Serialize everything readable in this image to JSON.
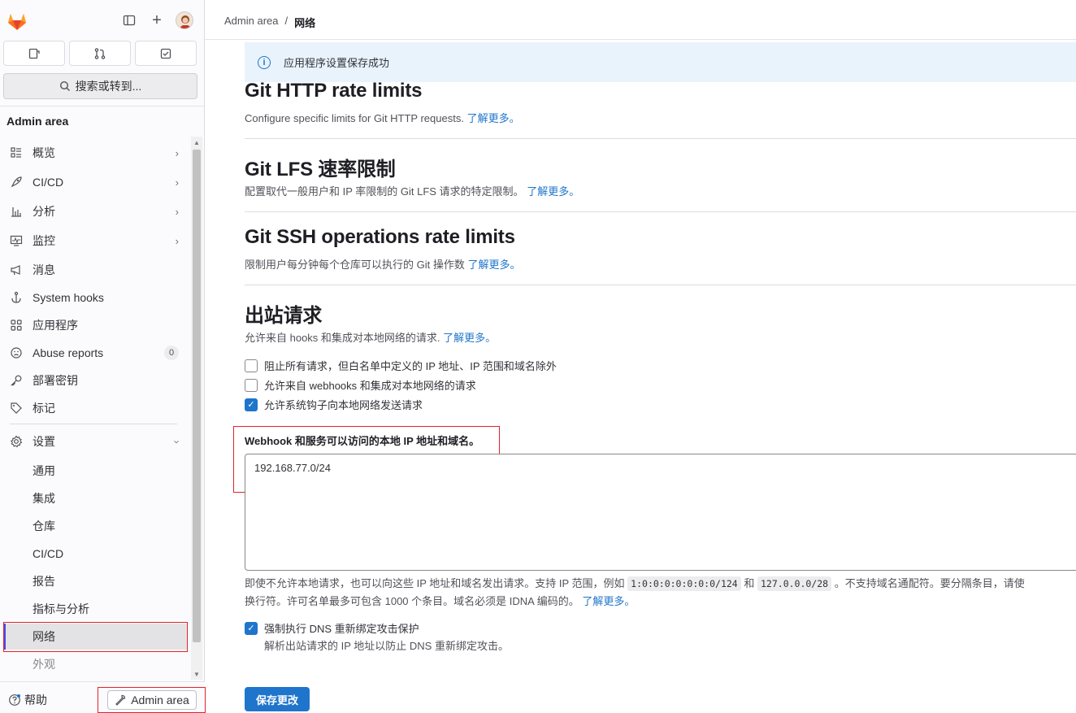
{
  "sidebar": {
    "search_label": "搜索或转到...",
    "section_title": "Admin area",
    "items": [
      {
        "label": "概览",
        "icon": "overview-icon"
      },
      {
        "label": "CI/CD",
        "icon": "rocket-icon"
      },
      {
        "label": "分析",
        "icon": "chart-icon"
      },
      {
        "label": "监控",
        "icon": "monitor-icon"
      },
      {
        "label": "消息",
        "icon": "bullhorn-icon"
      },
      {
        "label": "System hooks",
        "icon": "anchor-icon"
      },
      {
        "label": "应用程序",
        "icon": "apps-icon"
      },
      {
        "label": "Abuse reports",
        "icon": "face-icon",
        "badge": "0"
      },
      {
        "label": "部署密钥",
        "icon": "key-icon"
      },
      {
        "label": "标记",
        "icon": "label-icon"
      },
      {
        "label": "设置",
        "icon": "settings-icon"
      }
    ],
    "sub_items": [
      "通用",
      "集成",
      "仓库",
      "CI/CD",
      "报告",
      "指标与分析",
      "网络",
      "外观"
    ],
    "help_label": "帮助",
    "admin_button_label": "Admin area"
  },
  "breadcrumb": {
    "root": "Admin area",
    "sep": "/",
    "current": "网络"
  },
  "alert": {
    "text": "应用程序设置保存成功"
  },
  "sections": [
    {
      "title": "Git HTTP rate limits",
      "desc": "Configure specific limits for Git HTTP requests.",
      "link": "了解更多。"
    },
    {
      "title": "Git LFS 速率限制",
      "desc": "配置取代一般用户和 IP 率限制的 Git LFS 请求的特定限制。",
      "link": "了解更多。"
    },
    {
      "title": "Git SSH operations rate limits",
      "desc": "限制用户每分钟每个仓库可以执行的 Git 操作数",
      "link": "了解更多。"
    },
    {
      "title": "出站请求",
      "desc": "允许来自 hooks 和集成对本地网络的请求.",
      "link": "了解更多。"
    }
  ],
  "checkboxes": [
    {
      "label": "阻止所有请求，但白名单中定义的 IP 地址、IP 范围和域名除外",
      "checked": false
    },
    {
      "label": "允许来自 webhooks 和集成对本地网络的请求",
      "checked": false
    },
    {
      "label": "允许系统钩子向本地网络发送请求",
      "checked": true
    }
  ],
  "allowlist": {
    "label": "Webhook 和服务可以访问的本地 IP 地址和域名。",
    "value": "192.168.77.0/24",
    "help_1": "即使不允许本地请求，也可以向这些 IP 地址和域名发出请求。支持 IP 范围，例如",
    "code_1": "1:0:0:0:0:0:0:0/124",
    "help_and": "和",
    "code_2": "127.0.0.0/28",
    "help_2": "。不支持域名通配符。要分隔条目，请使",
    "help_3": "换行符。许可名单最多可包含 1000 个条目。域名必须是 IDNA 编码的。",
    "link": "了解更多。"
  },
  "dns": {
    "label": "强制执行 DNS 重新绑定攻击保护",
    "desc": "解析出站请求的 IP 地址以防止 DNS 重新绑定攻击。",
    "checked": true
  },
  "save_label": "保存更改",
  "colors": {
    "accent": "#1f75cb",
    "highlight": "#e0242b",
    "alert_bg": "#e9f3fc"
  }
}
